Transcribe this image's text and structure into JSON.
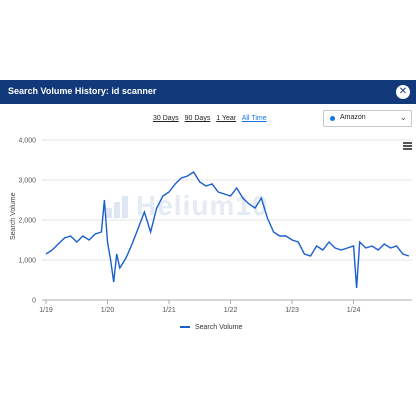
{
  "dialog": {
    "title": "Search Volume History: id scanner",
    "close_label": "✕"
  },
  "ranges": [
    {
      "label": "30 Days",
      "active": false
    },
    {
      "label": "90 Days",
      "active": false
    },
    {
      "label": "1 Year",
      "active": false
    },
    {
      "label": "All Time",
      "active": true
    }
  ],
  "marketplace": {
    "selected": "Amazon",
    "chevron": "⌄"
  },
  "watermark": "Helium10",
  "chart_data": {
    "type": "line",
    "title": "",
    "xlabel": "",
    "ylabel": "Search Volume",
    "ylim": [
      0,
      4000
    ],
    "yticks": [
      "0",
      "1,000",
      "2,000",
      "3,000",
      "4,000"
    ],
    "xticks": [
      "1/19",
      "1/20",
      "1/21",
      "1/22",
      "1/23",
      "1/24"
    ],
    "grid": true,
    "legend": "bottom-center",
    "color": "#1a5fcf",
    "series": [
      {
        "name": "Search Volume",
        "x": [
          2019.0,
          2019.1,
          2019.2,
          2019.3,
          2019.4,
          2019.5,
          2019.6,
          2019.7,
          2019.8,
          2019.9,
          2019.95,
          2020.0,
          2020.05,
          2020.1,
          2020.15,
          2020.2,
          2020.3,
          2020.4,
          2020.5,
          2020.6,
          2020.7,
          2020.8,
          2020.9,
          2021.0,
          2021.1,
          2021.2,
          2021.3,
          2021.4,
          2021.5,
          2021.6,
          2021.7,
          2021.8,
          2021.9,
          2022.0,
          2022.1,
          2022.2,
          2022.3,
          2022.4,
          2022.5,
          2022.6,
          2022.7,
          2022.8,
          2022.9,
          2023.0,
          2023.1,
          2023.2,
          2023.3,
          2023.4,
          2023.5,
          2023.6,
          2023.7,
          2023.8,
          2023.9,
          2024.0,
          2024.05,
          2024.1,
          2024.2,
          2024.3,
          2024.4,
          2024.5,
          2024.6,
          2024.7,
          2024.8,
          2024.9
        ],
        "values": [
          1150,
          1250,
          1400,
          1550,
          1600,
          1450,
          1600,
          1500,
          1650,
          1700,
          2500,
          1450,
          1000,
          450,
          1150,
          800,
          1050,
          1400,
          1800,
          2200,
          1700,
          2300,
          2600,
          2700,
          2900,
          3050,
          3100,
          3200,
          2950,
          2850,
          2900,
          2700,
          2650,
          2600,
          2800,
          2550,
          2400,
          2300,
          2550,
          2050,
          1700,
          1600,
          1600,
          1500,
          1450,
          1150,
          1100,
          1350,
          1250,
          1450,
          1300,
          1250,
          1300,
          1350,
          300,
          1450,
          1300,
          1350,
          1250,
          1400,
          1300,
          1350,
          1150,
          1100
        ]
      }
    ]
  }
}
